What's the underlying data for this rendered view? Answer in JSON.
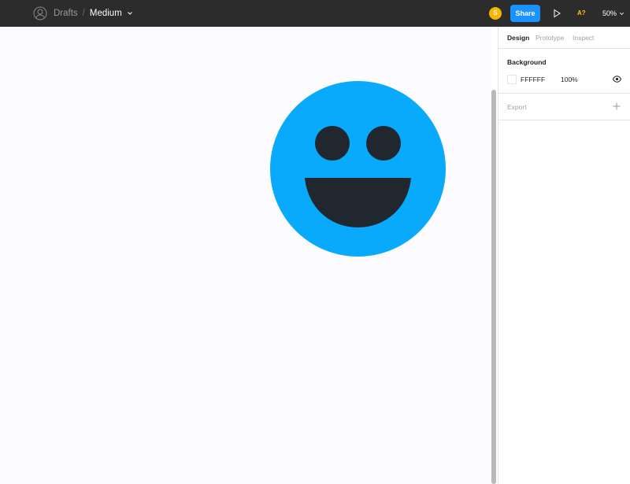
{
  "toolbar": {
    "project": "Drafts",
    "separator": "/",
    "file_name": "Medium",
    "avatar_initial": "S",
    "share_label": "Share",
    "font_status": "A?",
    "zoom": "50%"
  },
  "canvas": {
    "background": "#fcfcfe",
    "shape": {
      "fill": "#09a9fc",
      "feature_color": "#20272f"
    }
  },
  "panel": {
    "tabs": [
      {
        "label": "Design",
        "active": true
      },
      {
        "label": "Prototype",
        "active": false
      },
      {
        "label": "Inspect",
        "active": false
      }
    ],
    "background_section": {
      "title": "Background",
      "hex": "FFFFFF",
      "opacity": "100%"
    },
    "export_section": {
      "title": "Export"
    }
  },
  "colors": {
    "toolbar": "#2c2c2c",
    "accent": "#1a92ff",
    "avatar": "#f5b700",
    "warning": "#ffc700"
  }
}
